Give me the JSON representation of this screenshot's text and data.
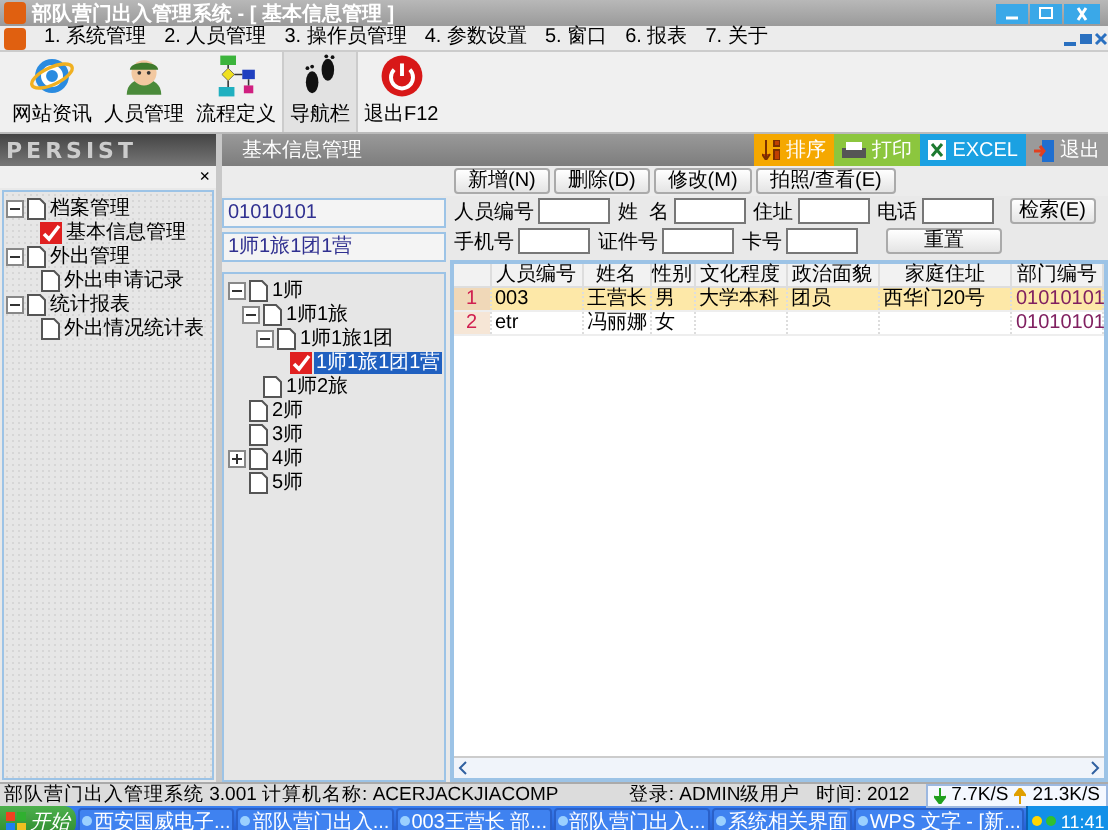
{
  "window": {
    "title": "部队营门出入管理系统 - [ 基本信息管理 ]"
  },
  "menu": [
    "1. 系统管理",
    "2. 人员管理",
    "3. 操作员管理",
    "4. 参数设置",
    "5. 窗口",
    "6. 报表",
    "7. 关于"
  ],
  "toolbar": [
    {
      "kind": "globe",
      "label": "网站资讯"
    },
    {
      "kind": "person",
      "label": "人员管理"
    },
    {
      "kind": "flow",
      "label": "流程定义"
    },
    {
      "kind": "feet",
      "label": "导航栏"
    },
    {
      "kind": "power",
      "label": "退出F12"
    }
  ],
  "sidebar": {
    "brand": "PERSIST",
    "close": "×",
    "tree": [
      {
        "kind": "folder",
        "label": "档案管理",
        "expanded": true,
        "selected": false,
        "children": [
          {
            "kind": "leaf",
            "label": "基本信息管理",
            "selected": true
          }
        ]
      },
      {
        "kind": "folder",
        "label": "外出管理",
        "expanded": true,
        "selected": false,
        "children": [
          {
            "kind": "leaf",
            "label": "外出申请记录",
            "selected": false
          }
        ]
      },
      {
        "kind": "folder",
        "label": "统计报表",
        "expanded": true,
        "selected": false,
        "children": [
          {
            "kind": "leaf",
            "label": "外出情况统计表",
            "selected": false
          }
        ]
      }
    ]
  },
  "page": {
    "title": "基本信息管理",
    "tools": [
      {
        "kind": "sort",
        "label": "排序",
        "color": "#f5a800"
      },
      {
        "kind": "print",
        "label": "打印",
        "color": "#8cc63e"
      },
      {
        "kind": "excel",
        "label": "EXCEL",
        "color": "#1ba1e2"
      },
      {
        "kind": "exit",
        "label": "退出",
        "color": "#9a9a9a"
      }
    ],
    "actions": [
      "新增(N)",
      "删除(D)",
      "修改(M)",
      "拍照/查看(E)"
    ],
    "dept_code": "01010101",
    "dept_name": "1师1旅1团1营",
    "dept_tree": [
      {
        "kind": "folder",
        "label": "1师",
        "expanded": true,
        "selected": false,
        "children": [
          {
            "kind": "folder",
            "label": "1师1旅",
            "expanded": true,
            "selected": false,
            "children": [
              {
                "kind": "folder",
                "label": "1师1旅1团",
                "expanded": true,
                "selected": false,
                "children": [
                  {
                    "kind": "leaf",
                    "label": "1师1旅1团1营",
                    "selected": true
                  }
                ]
              }
            ]
          },
          {
            "kind": "leaf",
            "label": "1师2旅",
            "selected": false
          }
        ]
      },
      {
        "kind": "leaf",
        "label": "2师",
        "selected": false
      },
      {
        "kind": "leaf",
        "label": "3师",
        "selected": false
      },
      {
        "kind": "folder",
        "label": "4师",
        "expanded": false,
        "selected": false
      },
      {
        "kind": "leaf",
        "label": "5师",
        "selected": false
      }
    ],
    "filters": [
      [
        {
          "label": "人员编号"
        },
        {
          "label": "姓  名"
        },
        {
          "label": "住址"
        },
        {
          "label": "电话"
        }
      ],
      [
        {
          "label": "手机号"
        },
        {
          "label": "证件号"
        },
        {
          "label": "卡号"
        }
      ]
    ],
    "search_button": "检索(E)",
    "reset_button": "重置",
    "table": {
      "columns": [
        "人员编号",
        "姓名",
        "性别",
        "文化程度",
        "政治面貌",
        "家庭住址",
        "部门编号"
      ],
      "rows": [
        {
          "index": "1",
          "selected": true,
          "cells": [
            "003",
            "王营长",
            "男",
            "大学本科",
            "团员",
            "西华门20号",
            "01010101"
          ]
        },
        {
          "index": "2",
          "selected": false,
          "cells": [
            "etr",
            "冯丽娜",
            "女",
            "",
            "",
            "",
            "01010101"
          ]
        }
      ]
    }
  },
  "status_bar": {
    "app": "部队营门出入管理系统 3.001 计算机名称: ACERJACKJIACOMP",
    "login": "登录: ADMIN级用户",
    "time": "时间: 2012",
    "down": "7.7K/S",
    "up": "21.3K/S"
  },
  "taskbar": {
    "start": "开始",
    "items": [
      "西安国威电子...",
      "部队营门出入...",
      "003王营长 部...",
      "部队营门出入...",
      "系统相关界面",
      "WPS 文字 - [新..."
    ],
    "clock": "11:41"
  }
}
